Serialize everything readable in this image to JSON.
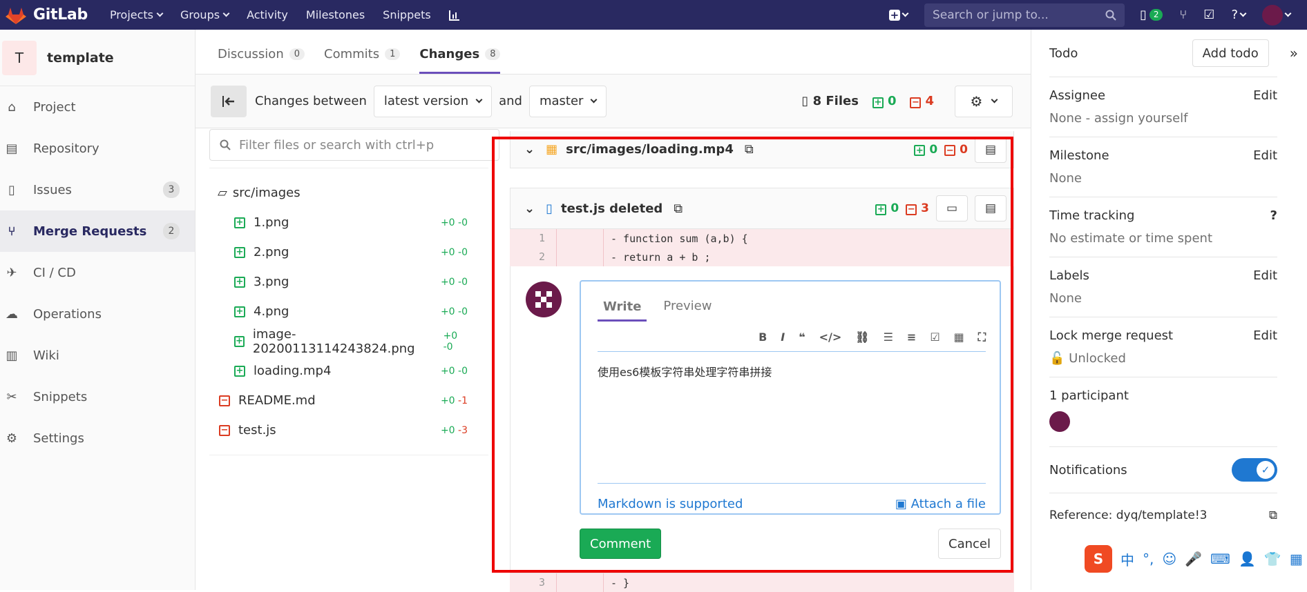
{
  "topbar": {
    "brand": "GitLab",
    "nav": [
      "Projects",
      "Groups",
      "Activity",
      "Milestones",
      "Snippets"
    ],
    "search_placeholder": "Search or jump to...",
    "mr_count": "2"
  },
  "sidebar": {
    "project_initial": "T",
    "project_name": "template",
    "items": [
      {
        "label": "Project",
        "count": ""
      },
      {
        "label": "Repository",
        "count": ""
      },
      {
        "label": "Issues",
        "count": "3"
      },
      {
        "label": "Merge Requests",
        "count": "2"
      },
      {
        "label": "CI / CD",
        "count": ""
      },
      {
        "label": "Operations",
        "count": ""
      },
      {
        "label": "Wiki",
        "count": ""
      },
      {
        "label": "Snippets",
        "count": ""
      },
      {
        "label": "Settings",
        "count": ""
      }
    ]
  },
  "tabs": [
    {
      "label": "Discussion",
      "count": "0"
    },
    {
      "label": "Commits",
      "count": "1"
    },
    {
      "label": "Changes",
      "count": "8"
    }
  ],
  "toolbar": {
    "changes_between": "Changes between",
    "from_version": "latest version",
    "and": "and",
    "to_version": "master",
    "files": "8 Files",
    "added": "0",
    "removed": "4"
  },
  "filetree": {
    "filter_placeholder": "Filter files or search with ctrl+p",
    "folder": "src/images",
    "files": [
      {
        "name": "1.png",
        "stat": "+0 -0",
        "type": "added",
        "nested": true
      },
      {
        "name": "2.png",
        "stat": "+0 -0",
        "type": "added",
        "nested": true
      },
      {
        "name": "3.png",
        "stat": "+0 -0",
        "type": "added",
        "nested": true
      },
      {
        "name": "4.png",
        "stat": "+0 -0",
        "type": "added",
        "nested": true
      },
      {
        "name": "image-20200113114243824.png",
        "stat": "+0 -0",
        "type": "added",
        "nested": true
      },
      {
        "name": "loading.mp4",
        "stat": "+0 -0",
        "type": "added",
        "nested": true
      },
      {
        "name": "README.md",
        "stat": "+0 -1",
        "type": "deleted",
        "nested": false
      },
      {
        "name": "test.js",
        "stat": "+0 -3",
        "type": "deleted",
        "nested": false
      }
    ]
  },
  "diff": {
    "file1": {
      "path": "src/images/loading.mp4",
      "added": "0",
      "removed": "0"
    },
    "file2": {
      "path": "test.js deleted",
      "added": "0",
      "removed": "3"
    },
    "lines": [
      {
        "num": "1",
        "code": "- function sum (a,b) {"
      },
      {
        "num": "2",
        "code": "-     return a + b ;"
      }
    ],
    "last_line_num": "3",
    "last_line_code": "- }"
  },
  "comment": {
    "tab_write": "Write",
    "tab_preview": "Preview",
    "text": "使用es6模板字符串处理字符串拼接",
    "markdown_hint": "Markdown is supported",
    "attach": "Attach a file",
    "submit": "Comment",
    "cancel": "Cancel"
  },
  "right": {
    "todo": "Todo",
    "add_todo": "Add todo",
    "assignee": "Assignee",
    "assignee_value": "None - assign yourself",
    "edit": "Edit",
    "milestone": "Milestone",
    "milestone_value": "None",
    "time_tracking": "Time tracking",
    "time_value": "No estimate or time spent",
    "labels": "Labels",
    "labels_value": "None",
    "lock": "Lock merge request",
    "lock_value": "Unlocked",
    "participants": "1 participant",
    "notifications": "Notifications",
    "reference": "Reference: dyq/template!3"
  },
  "colors": {
    "header": "#292961",
    "added": "#1aaa55",
    "removed": "#db3b21",
    "accent": "#1f78d1"
  }
}
